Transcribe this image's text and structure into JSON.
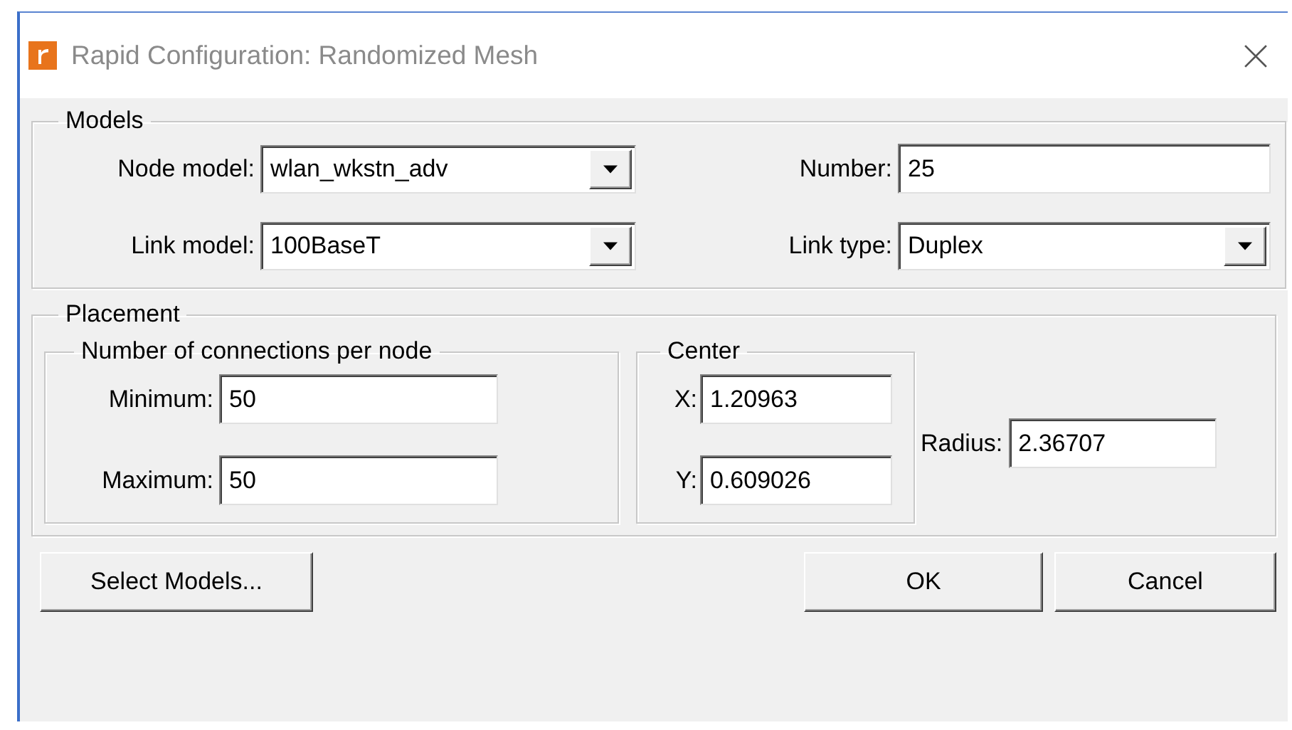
{
  "window": {
    "title": "Rapid Configuration: Randomized Mesh"
  },
  "models": {
    "legend": "Models",
    "fields": [
      {
        "kind": "combo",
        "label": "Node model:",
        "value": "wlan_wkstn_adv"
      },
      {
        "kind": "text",
        "label": "Number:",
        "value": "25"
      },
      {
        "kind": "combo",
        "label": "Link model:",
        "value": "100BaseT"
      },
      {
        "kind": "combo",
        "label": "Link type:",
        "value": "Duplex"
      }
    ]
  },
  "placement": {
    "legend": "Placement",
    "connections": {
      "legend": "Number of connections per node",
      "fields": [
        {
          "label": "Minimum:",
          "value": "50"
        },
        {
          "label": "Maximum:",
          "value": "50"
        }
      ]
    },
    "center": {
      "legend": "Center",
      "fields": [
        {
          "label": "X:",
          "value": "1.20963"
        },
        {
          "label": "Y:",
          "value": "0.609026"
        }
      ]
    },
    "radius": {
      "label": "Radius:",
      "value": "2.36707"
    }
  },
  "buttons": [
    {
      "label": "Select Models..."
    },
    {
      "label": "OK"
    },
    {
      "label": "Cancel"
    }
  ]
}
